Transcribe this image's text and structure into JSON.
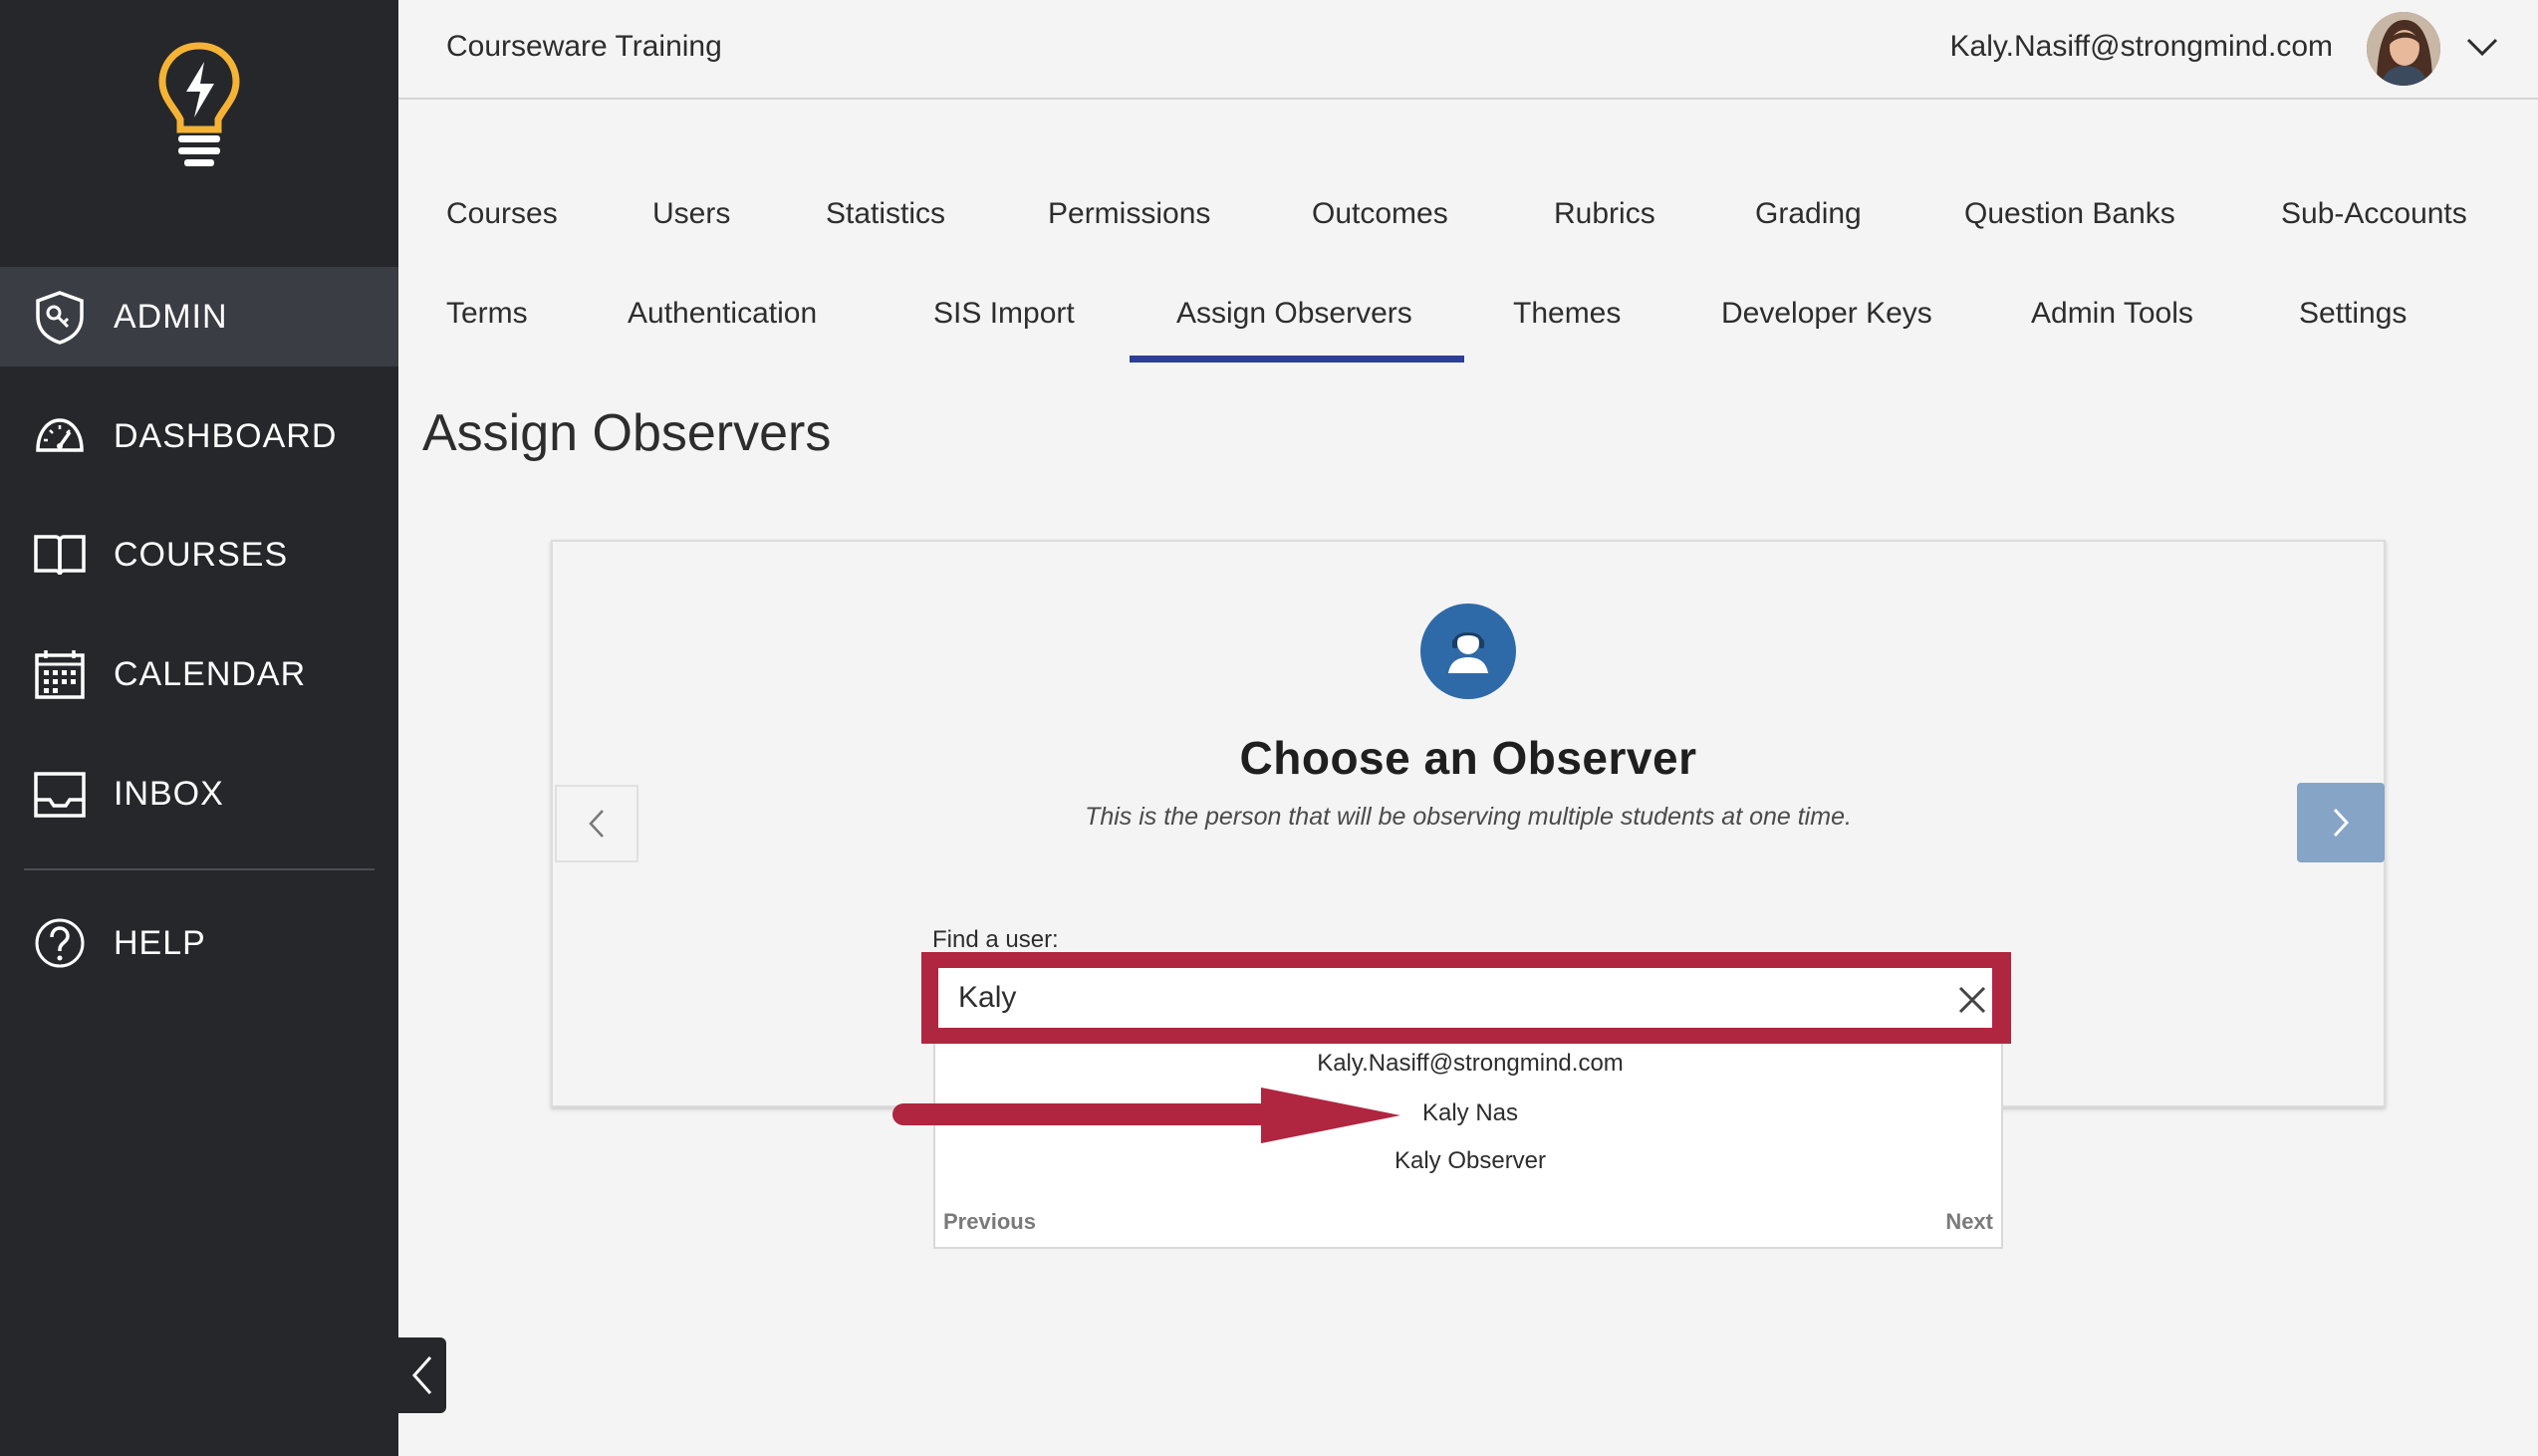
{
  "header": {
    "title": "Courseware Training",
    "user_email": "Kaly.Nasiff@strongmind.com"
  },
  "sidebar": {
    "items": [
      {
        "label": "ADMIN",
        "icon": "admin-shield-icon",
        "active": true
      },
      {
        "label": "DASHBOARD",
        "icon": "dashboard-gauge-icon"
      },
      {
        "label": "COURSES",
        "icon": "book-icon"
      },
      {
        "label": "CALENDAR",
        "icon": "calendar-icon"
      },
      {
        "label": "INBOX",
        "icon": "inbox-icon"
      },
      {
        "label": "HELP",
        "icon": "help-icon"
      }
    ]
  },
  "tabs": {
    "row1": [
      "Courses",
      "Users",
      "Statistics",
      "Permissions",
      "Outcomes",
      "Rubrics",
      "Grading",
      "Question Banks",
      "Sub-Accounts"
    ],
    "row2": [
      "Terms",
      "Authentication",
      "SIS Import",
      "Assign Observers",
      "Themes",
      "Developer Keys",
      "Admin Tools",
      "Settings"
    ],
    "active": "Assign Observers"
  },
  "page": {
    "title": "Assign Observers"
  },
  "card": {
    "title": "Choose an Observer",
    "subtitle": "This is the person that will be observing multiple students at one time.",
    "find_label": "Find a user:",
    "search_value": "Kaly"
  },
  "dropdown": {
    "results": [
      "Kaly.Nasiff@strongmind.com",
      "Kaly Nas",
      "Kaly Observer"
    ],
    "previous_label": "Previous",
    "next_label": "Next"
  },
  "colors": {
    "sidebar_bg": "#25272b",
    "accent_blue": "#2c3f95",
    "observer_blue": "#2f6aa8",
    "highlight_red": "#b0253f",
    "next_button": "#86a4c6",
    "logo_yellow": "#f5b335"
  }
}
